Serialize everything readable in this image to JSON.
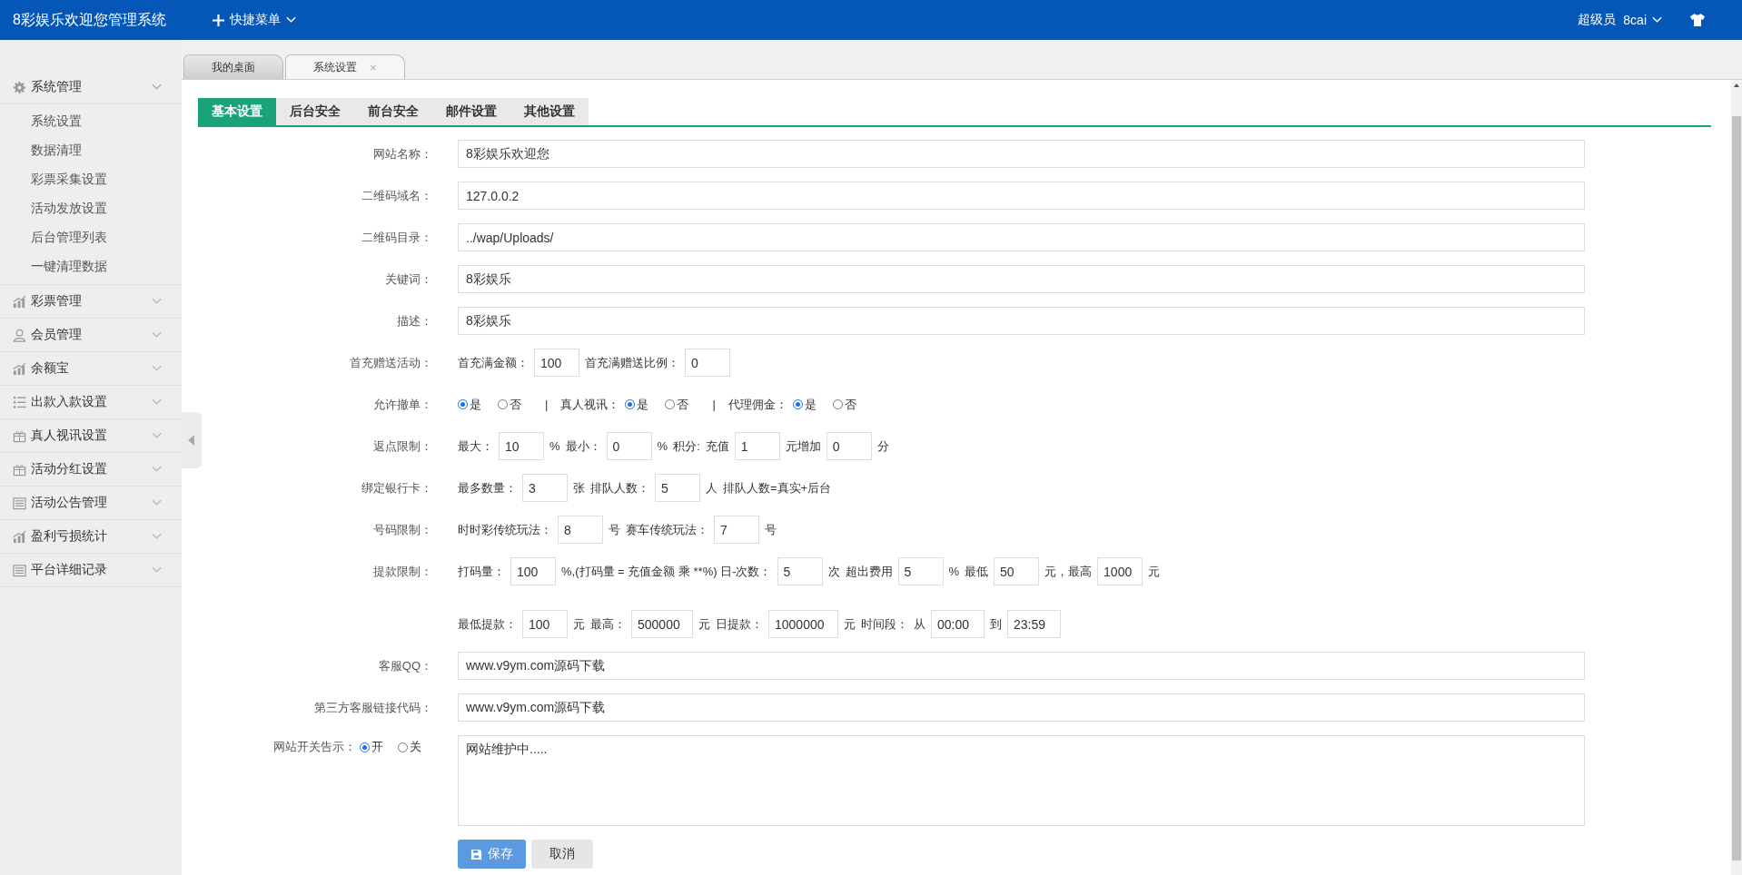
{
  "header": {
    "title": "8彩娱乐欢迎您管理系统",
    "quick_menu": "快捷菜单",
    "role": "超级员",
    "user": "8cai"
  },
  "sidebar": {
    "groups": [
      {
        "label": "系统管理",
        "expanded": true,
        "children": [
          "系统设置",
          "数据清理",
          "彩票采集设置",
          "活动发放设置",
          "后台管理列表",
          "一键清理数据"
        ]
      },
      {
        "label": "彩票管理",
        "expanded": false
      },
      {
        "label": "会员管理",
        "expanded": false
      },
      {
        "label": "余额宝",
        "expanded": false
      },
      {
        "label": "出款入款设置",
        "expanded": false
      },
      {
        "label": "真人视讯设置",
        "expanded": false
      },
      {
        "label": "活动分红设置",
        "expanded": false
      },
      {
        "label": "活动公告管理",
        "expanded": false
      },
      {
        "label": "盈利亏损统计",
        "expanded": false
      },
      {
        "label": "平台详细记录",
        "expanded": false
      }
    ]
  },
  "page_tabs": [
    {
      "label": "我的桌面",
      "selected": false
    },
    {
      "label": "系统设置",
      "selected": true,
      "close": "×"
    }
  ],
  "settings_tabs": [
    {
      "label": "基本设置",
      "selected": true
    },
    {
      "label": "后台安全",
      "selected": false
    },
    {
      "label": "前台安全",
      "selected": false
    },
    {
      "label": "邮件设置",
      "selected": false
    },
    {
      "label": "其他设置",
      "selected": false
    }
  ],
  "form": {
    "rows": [
      {
        "kind": "text",
        "label": "网站名称：",
        "value": "8彩娱乐欢迎您"
      },
      {
        "kind": "text",
        "label": "二维码域名：",
        "value": "127.0.0.2"
      },
      {
        "kind": "text",
        "label": "二维码目录：",
        "value": "../wap/Uploads/"
      },
      {
        "kind": "text",
        "label": "关键词：",
        "value": "8彩娱乐"
      },
      {
        "kind": "text",
        "label": "描述：",
        "value": "8彩娱乐"
      },
      {
        "kind": "inline",
        "label": "首充赠送活动：",
        "parts": [
          {
            "kind": "text",
            "text": "首充满金额："
          },
          {
            "kind": "input",
            "value": "100"
          },
          {
            "kind": "text",
            "text": "首充满赠送比例："
          },
          {
            "kind": "input",
            "value": "0"
          }
        ]
      },
      {
        "kind": "inline",
        "label": "允许撤单：",
        "parts": [
          {
            "kind": "radio",
            "text": "是",
            "selected": true
          },
          {
            "kind": "radio",
            "text": "否",
            "selected": false
          },
          {
            "kind": "sep",
            "text": "|"
          },
          {
            "kind": "text",
            "text": "真人视讯："
          },
          {
            "kind": "radio",
            "text": "是",
            "selected": true
          },
          {
            "kind": "radio",
            "text": "否",
            "selected": false
          },
          {
            "kind": "sep",
            "text": "|"
          },
          {
            "kind": "text",
            "text": "代理佣金："
          },
          {
            "kind": "radio",
            "text": "是",
            "selected": true
          },
          {
            "kind": "radio",
            "text": "否",
            "selected": false
          }
        ]
      },
      {
        "kind": "inline",
        "label": "返点限制：",
        "parts": [
          {
            "kind": "text",
            "text": "最大："
          },
          {
            "kind": "input",
            "value": "10"
          },
          {
            "kind": "text",
            "text": "%"
          },
          {
            "kind": "text",
            "text": "最小："
          },
          {
            "kind": "input",
            "value": "0"
          },
          {
            "kind": "text",
            "text": "%"
          },
          {
            "kind": "text",
            "text": "积分:"
          },
          {
            "kind": "text",
            "text": "充值"
          },
          {
            "kind": "input",
            "value": "1"
          },
          {
            "kind": "text",
            "text": "元增加"
          },
          {
            "kind": "input",
            "value": "0"
          },
          {
            "kind": "text",
            "text": "分"
          }
        ]
      },
      {
        "kind": "inline",
        "label": "绑定银行卡：",
        "parts": [
          {
            "kind": "text",
            "text": "最多数量："
          },
          {
            "kind": "input",
            "value": "3"
          },
          {
            "kind": "text",
            "text": "张"
          },
          {
            "kind": "text",
            "text": "排队人数："
          },
          {
            "kind": "input",
            "value": "5"
          },
          {
            "kind": "text",
            "text": "人"
          },
          {
            "kind": "text",
            "text": "排队人数=真实+后台"
          }
        ]
      },
      {
        "kind": "inline",
        "label": "号码限制：",
        "parts": [
          {
            "kind": "text",
            "text": "时时彩传统玩法："
          },
          {
            "kind": "input",
            "value": "8"
          },
          {
            "kind": "text",
            "text": "号"
          },
          {
            "kind": "text",
            "text": "赛车传统玩法："
          },
          {
            "kind": "input",
            "value": "7"
          },
          {
            "kind": "text",
            "text": "号"
          }
        ]
      },
      {
        "kind": "inline",
        "label": "提款限制：",
        "parts": [
          {
            "kind": "text",
            "text": "打码量："
          },
          {
            "kind": "input",
            "value": "100"
          },
          {
            "kind": "text",
            "text": "%,(打码量 = 充值金额 乘 **%) 日-次数："
          },
          {
            "kind": "input",
            "value": "5"
          },
          {
            "kind": "text",
            "text": "次"
          },
          {
            "kind": "text",
            "text": "超出费用"
          },
          {
            "kind": "input",
            "value": "5"
          },
          {
            "kind": "text",
            "text": "%"
          },
          {
            "kind": "text",
            "text": "最低"
          },
          {
            "kind": "input",
            "value": "50"
          },
          {
            "kind": "text",
            "text": "元，最高"
          },
          {
            "kind": "input",
            "value": "1000"
          },
          {
            "kind": "text",
            "text": "元"
          }
        ]
      },
      {
        "kind": "inline",
        "parts": [
          {
            "kind": "text",
            "text": "最低提款："
          },
          {
            "kind": "input",
            "value": "100"
          },
          {
            "kind": "text",
            "text": "元"
          },
          {
            "kind": "text",
            "text": "最高："
          },
          {
            "kind": "input",
            "value": "500000"
          },
          {
            "kind": "text",
            "text": "元"
          },
          {
            "kind": "text",
            "text": "日提款："
          },
          {
            "kind": "input",
            "value": "1000000"
          },
          {
            "kind": "text",
            "text": "元"
          },
          {
            "kind": "text",
            "text": "时间段："
          },
          {
            "kind": "text",
            "text": "从"
          },
          {
            "kind": "input",
            "value": "00:00"
          },
          {
            "kind": "text",
            "text": "到"
          },
          {
            "kind": "input",
            "value": "23:59"
          }
        ]
      },
      {
        "kind": "text",
        "label": "客服QQ：",
        "value": "www.v9ym.com源码下载"
      },
      {
        "kind": "text",
        "label": "第三方客服链接代码：",
        "value": "www.v9ym.com源码下载"
      },
      {
        "kind": "textarea",
        "label": "网站开关告示：",
        "options": [
          {
            "text": "开",
            "selected": true
          },
          {
            "text": "关",
            "selected": false
          }
        ],
        "value": "网站维护中....."
      }
    ],
    "buttons": [
      {
        "kind": "primary",
        "label": "保存"
      },
      {
        "kind": "secondary",
        "label": "取消"
      }
    ]
  }
}
